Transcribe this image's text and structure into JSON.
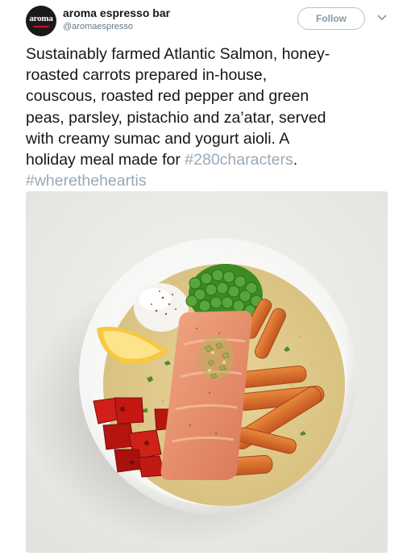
{
  "account": {
    "avatar_text": "aroma",
    "display_name": "aroma espresso bar",
    "handle": "@aromaespresso",
    "follow_label": "Follow"
  },
  "icons": {
    "more": "chevron-down-icon"
  },
  "tweet": {
    "line1": "Sustainably farmed Atlantic Salmon, honey-",
    "line2": "roasted carrots prepared in-house,",
    "line3": "couscous, roasted red pepper and green",
    "line4": "peas, parsley, pistachio and za’atar, served",
    "line5_pre": "with creamy sumac and yogurt aioli. A",
    "line6_pre": "holiday meal made for ",
    "hashtag1": "#280characters",
    "line6_post": ".",
    "hashtag2": "#wheretheheartis"
  },
  "colors": {
    "hashtag": "#9aa9b6",
    "avatar_bg": "#1a1a1a",
    "avatar_accent": "#c8102e"
  }
}
